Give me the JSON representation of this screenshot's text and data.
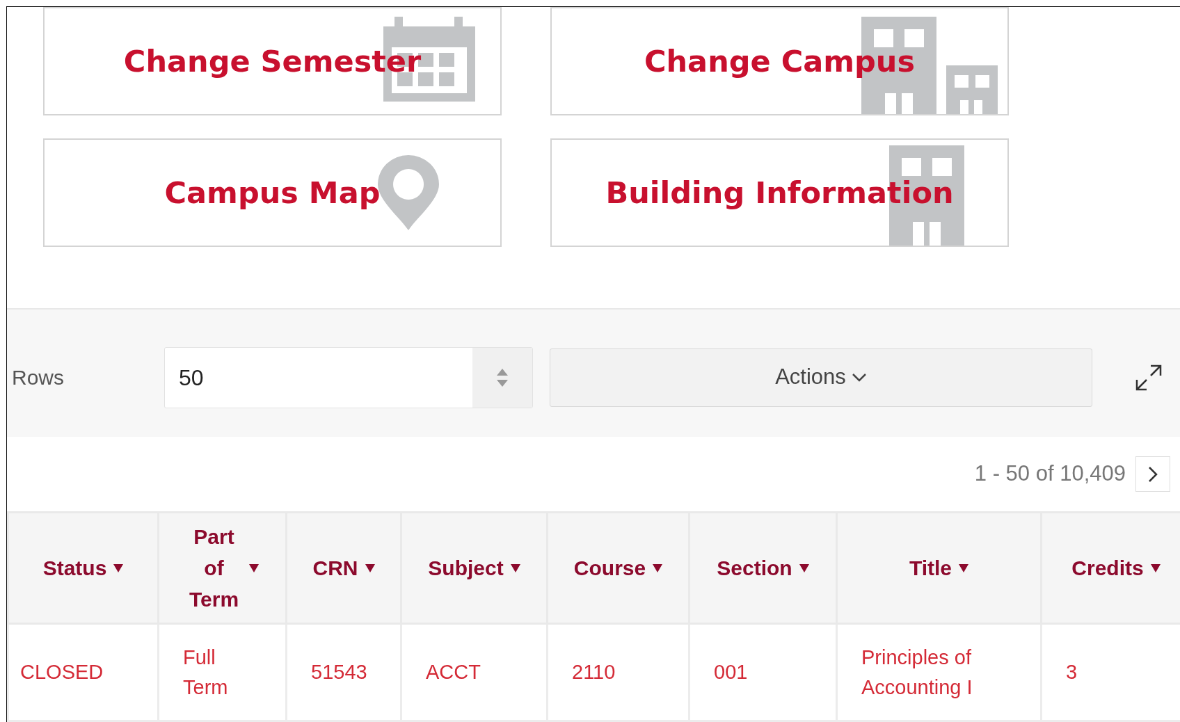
{
  "tiles": [
    {
      "label": "Change Semester",
      "kind": "calendar"
    },
    {
      "label": "Change Campus",
      "kind": "buildings"
    },
    {
      "label": "Campus Map",
      "kind": "pin"
    },
    {
      "label": "Building Information",
      "kind": "building"
    }
  ],
  "toolbar": {
    "rows_label": "Rows",
    "rows_value": "50",
    "actions": "Actions"
  },
  "pagination": {
    "range": "1 - 50 of 10,409"
  },
  "table": {
    "columns": [
      "Status",
      "Part of Term",
      "CRN",
      "Subject",
      "Course",
      "Section",
      "Title",
      "Credits"
    ],
    "rows": [
      [
        "CLOSED",
        "Full Term",
        "51543",
        "ACCT",
        "2110",
        "001",
        "Principles of Accounting I",
        "3"
      ]
    ]
  }
}
